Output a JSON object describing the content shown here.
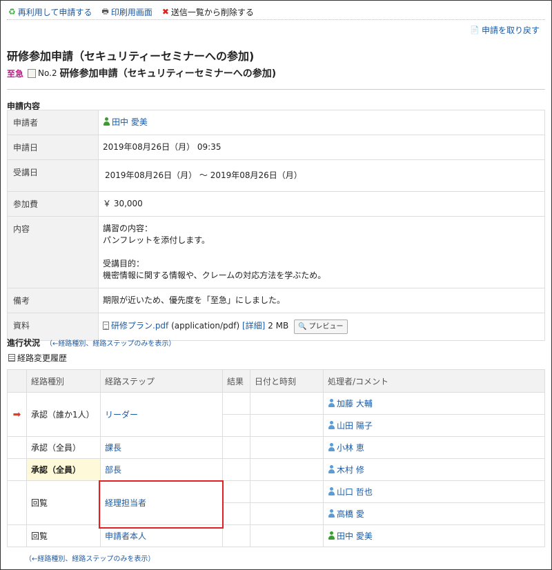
{
  "toolbar": {
    "reuse": "再利用して申請する",
    "print": "印刷用画面",
    "delete": "送信一覧から削除する"
  },
  "withdraw": "申請を取り戻す",
  "title": "研修参加申請（セキュリティーセミナーへの参加)",
  "subtitle": {
    "urgent": "至急",
    "number": "No.2",
    "name": "研修参加申請（セキュリティーセミナーへの参加)"
  },
  "section_heading": "申請内容",
  "detail": {
    "applicant_label": "申請者",
    "applicant": "田中 愛美",
    "date_label": "申請日",
    "date": "2019年08月26日（月） 09:35",
    "course_label": "受講日",
    "course_dates": "2019年08月26日（月） ～ 2019年08月26日（月）",
    "fee_label": "参加費",
    "fee": "￥ 30,000",
    "content_label": "内容",
    "content_lines": [
      "講習の内容：",
      "パンフレットを添付します。",
      "",
      "受講目的：",
      "機密情報に関する情報や、クレームの対応方法を学ぶため。"
    ],
    "remarks_label": "備考",
    "remarks": "期限が近いため、優先度を「至急」にしました。",
    "material_label": "資料",
    "file_name": "研修プラン.pdf",
    "file_type": "(application/pdf)",
    "file_detail": "[詳細]",
    "file_size": "2 MB",
    "preview": "プレビュー"
  },
  "progress": {
    "heading": "進行状況",
    "toggle_link": "（←経路種別、経路ステップのみを表示）",
    "history": "経路変更履歴",
    "columns": [
      "経路種別",
      "経路ステップ",
      "結果",
      "日付と時刻",
      "処理者/コメント"
    ],
    "rows": [
      {
        "type": "承認（誰か1人）",
        "step": "リーダー",
        "users": [
          "加藤 大輔",
          "山田 陽子"
        ]
      },
      {
        "type": "承認（全員）",
        "step": "課長",
        "users": [
          "小林 恵"
        ]
      },
      {
        "type": "承認（全員）",
        "step": "部長",
        "users": [
          "木村 修"
        ]
      },
      {
        "type": "回覧",
        "step": "経理担当者",
        "users": [
          "山口 哲也",
          "高橋 愛"
        ]
      },
      {
        "type": "回覧",
        "step": "申請者本人",
        "users": [
          "田中 愛美"
        ]
      }
    ],
    "footer_link": "（←経路種別、経路ステップのみを表示）"
  },
  "colors": {
    "link": "#1a5aa5",
    "urgent": "#c2188a",
    "current_arrow": "#e23b2b",
    "highlight": "#fef9d8",
    "red_box": "#e02020"
  }
}
